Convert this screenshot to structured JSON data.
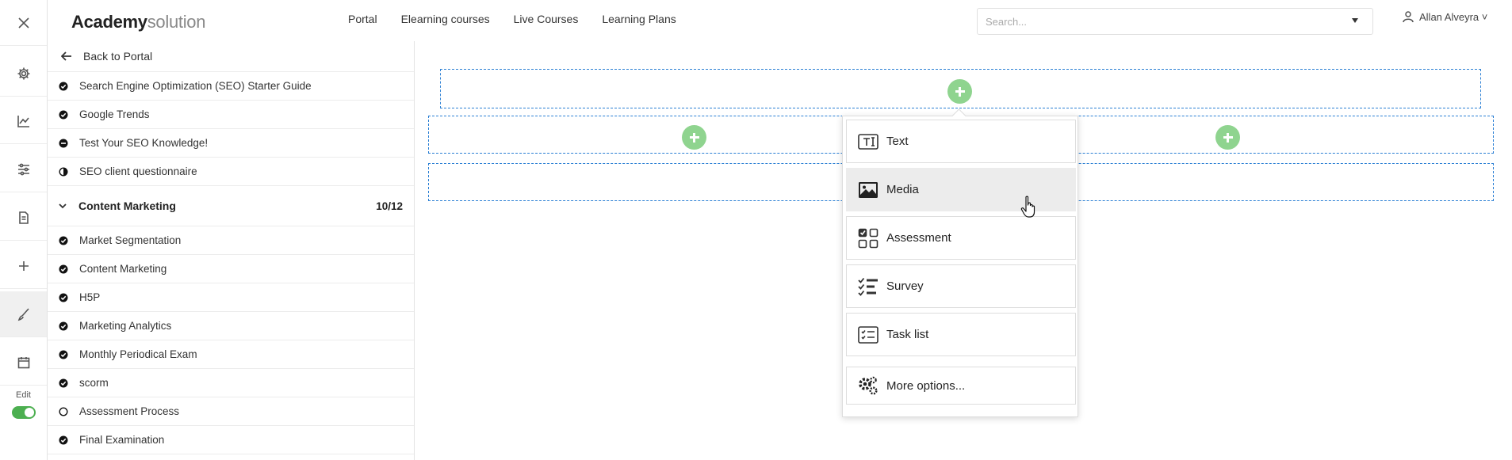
{
  "header": {
    "logo_bold": "Academy",
    "logo_light": "solution",
    "nav": [
      "Portal",
      "Elearning courses",
      "Live Courses",
      "Learning Plans"
    ],
    "search_placeholder": "Search...",
    "user_name": "Allan Alveyra ˅"
  },
  "rail": {
    "edit_label": "Edit",
    "edit_toggle_on": true
  },
  "sidebar": {
    "back_label": "Back to Portal",
    "items_top": [
      {
        "label": "Search Engine Optimization (SEO) Starter Guide",
        "status": "complete"
      },
      {
        "label": "Google Trends",
        "status": "complete"
      },
      {
        "label": "Test Your SEO Knowledge!",
        "status": "failed"
      },
      {
        "label": "SEO client questionnaire",
        "status": "in-progress"
      }
    ],
    "section": {
      "title": "Content Marketing",
      "count": "10/12"
    },
    "items_section": [
      {
        "label": "Market Segmentation",
        "status": "complete"
      },
      {
        "label": "Content Marketing",
        "status": "complete"
      },
      {
        "label": "H5P",
        "status": "complete"
      },
      {
        "label": "Marketing Analytics",
        "status": "complete"
      },
      {
        "label": "Monthly Periodical Exam",
        "status": "complete"
      },
      {
        "label": "scorm",
        "status": "complete"
      },
      {
        "label": "Assessment Process",
        "status": "not-started"
      },
      {
        "label": "Final Examination",
        "status": "complete"
      }
    ]
  },
  "popup": {
    "options": [
      {
        "label": "Text",
        "icon": "text-icon"
      },
      {
        "label": "Media",
        "icon": "image-icon"
      },
      {
        "label": "Assessment",
        "icon": "assessment-icon"
      },
      {
        "label": "Survey",
        "icon": "survey-icon"
      },
      {
        "label": "Task list",
        "icon": "task-list-icon"
      },
      {
        "label": "More options...",
        "icon": "gears-icon"
      }
    ],
    "hovered": "Media"
  },
  "colors": {
    "accent_green": "#8fd48f",
    "toggle_green": "#4caf50",
    "dashed_blue": "#2a7fd4"
  }
}
